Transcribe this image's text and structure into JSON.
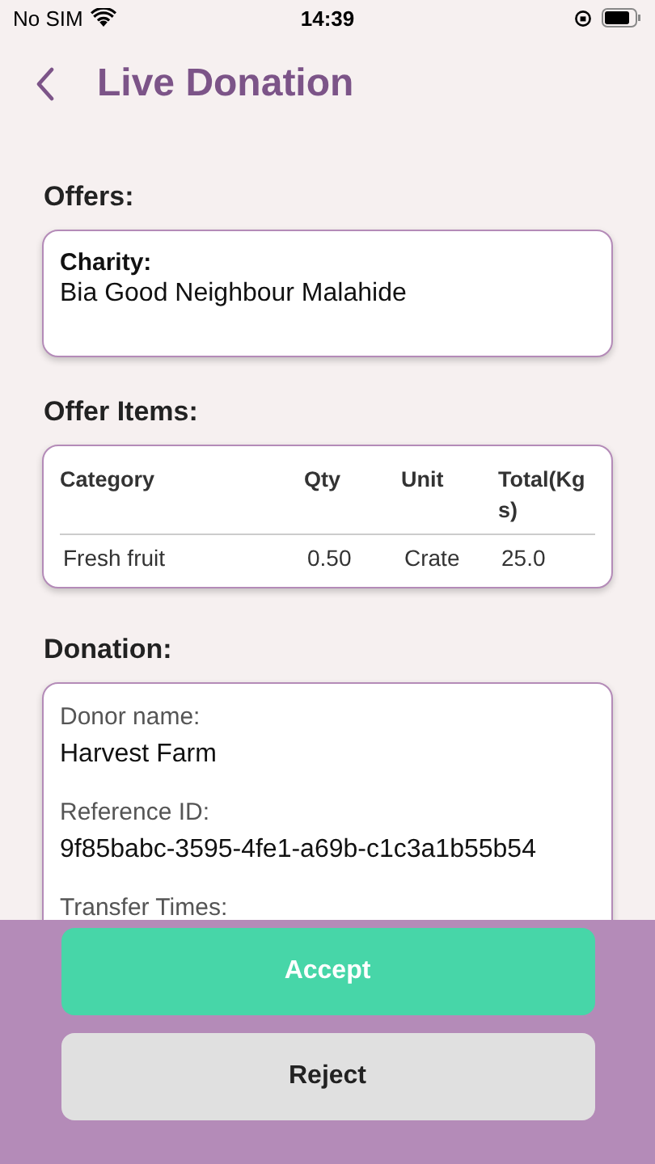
{
  "status_bar": {
    "carrier": "No SIM",
    "time": "14:39"
  },
  "header": {
    "title": "Live Donation"
  },
  "offers": {
    "heading": "Offers:",
    "label": "Charity:",
    "value": "Bia Good Neighbour Malahide"
  },
  "offer_items": {
    "heading": "Offer Items:",
    "columns": [
      "Category",
      "Qty",
      "Unit",
      "Total(Kgs)"
    ],
    "rows": [
      [
        "Fresh fruit",
        "0.50",
        "Crate",
        "25.0"
      ]
    ]
  },
  "donation": {
    "heading": "Donation:",
    "fields": [
      {
        "label": "Donor name:",
        "value": "Harvest Farm"
      },
      {
        "label": "Reference ID:",
        "value": "9f85babc-3595-4fe1-a69b-c1c3a1b55b54"
      },
      {
        "label": "Transfer Times:"
      }
    ]
  },
  "actions": [
    {
      "label": "Accept",
      "kind": "primary"
    },
    {
      "label": "Reject",
      "kind": "secondary"
    }
  ]
}
